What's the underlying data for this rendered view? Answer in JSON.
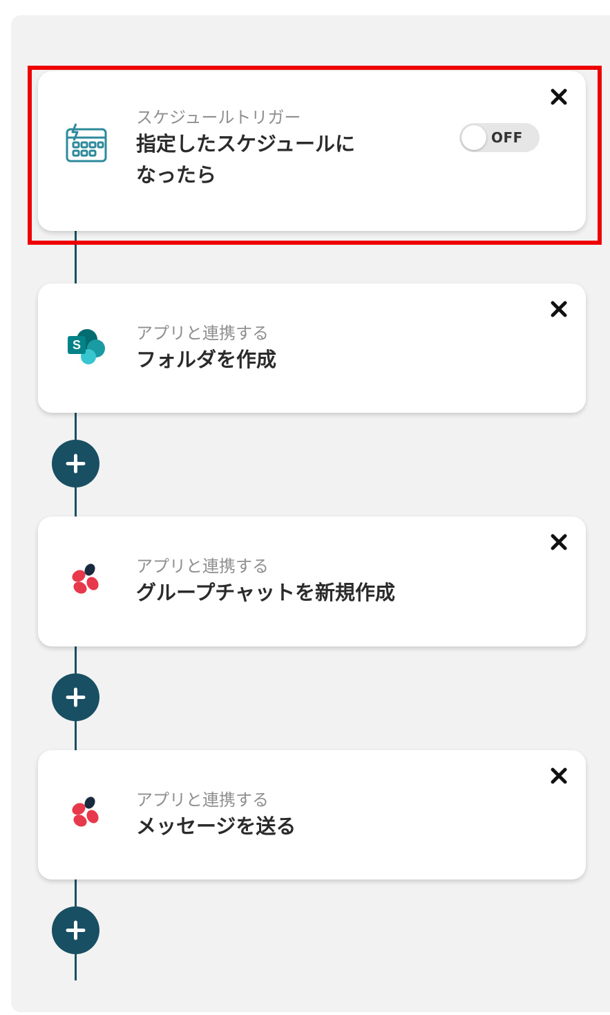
{
  "steps": [
    {
      "kind": "trigger",
      "sublabel": "スケジュールトリガー",
      "title": "指定したスケジュールになったら",
      "icon": "schedule-calendar-icon",
      "toggle_state": "OFF"
    },
    {
      "kind": "action",
      "sublabel": "アプリと連携する",
      "title": "フォルダを作成",
      "icon": "sharepoint-icon"
    },
    {
      "kind": "action",
      "sublabel": "アプリと連携する",
      "title": "グループチャットを新規作成",
      "icon": "chatwork-icon"
    },
    {
      "kind": "action",
      "sublabel": "アプリと連携する",
      "title": "メッセージを送る",
      "icon": "chatwork-icon"
    }
  ],
  "colors": {
    "accent": "#184f63",
    "highlight": "#ee0000",
    "panel_bg": "#f2f2f2",
    "schedule_icon": "#2d8a9a",
    "chatwork_red": "#e8394c",
    "chatwork_dark": "#1a2a3e",
    "sharepoint_teal": "#038387"
  },
  "icons": {
    "close": "close-icon",
    "add": "plus-icon"
  }
}
